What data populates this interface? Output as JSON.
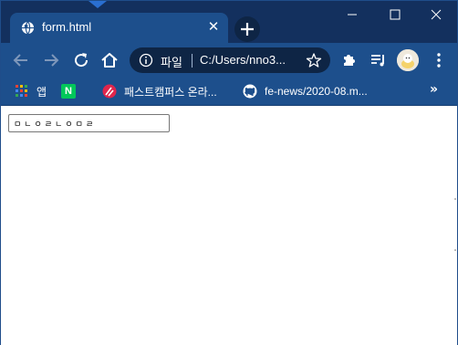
{
  "window": {
    "tab": {
      "title": "form.html",
      "close_glyph": "✕"
    },
    "new_tab_glyph": "+",
    "controls": {
      "minimize": "minimize-icon",
      "maximize": "maximize-icon",
      "close": "close-icon"
    }
  },
  "toolbar": {
    "back": "arrow-left-icon",
    "forward": "arrow-right-icon",
    "reload": "reload-icon",
    "home": "home-icon",
    "omnibox": {
      "scheme_label": "파일",
      "url": "C:/Users/nno3..."
    },
    "bookmark_star": "star-icon",
    "extensions": "puzzle-icon",
    "media": "playlist-icon",
    "profile": "avatar"
  },
  "bookmarks": {
    "items": [
      {
        "label": "앱",
        "icon": "apps-grid-icon"
      },
      {
        "label": "",
        "icon": "naver-icon",
        "icon_text": "N"
      },
      {
        "label": "패스트캠퍼스 온라...",
        "icon": "fastcampus-icon"
      },
      {
        "label": "fe-news/2020-08.m...",
        "icon": "github-icon"
      }
    ],
    "more": "»"
  },
  "page": {
    "input_value": "ㅁㄴㅇㄹㄴㅇㅁㄹ"
  },
  "colors": {
    "titlebar": "#13305e",
    "toolbar": "#1d4f8c",
    "omnibox": "#0e2545"
  }
}
